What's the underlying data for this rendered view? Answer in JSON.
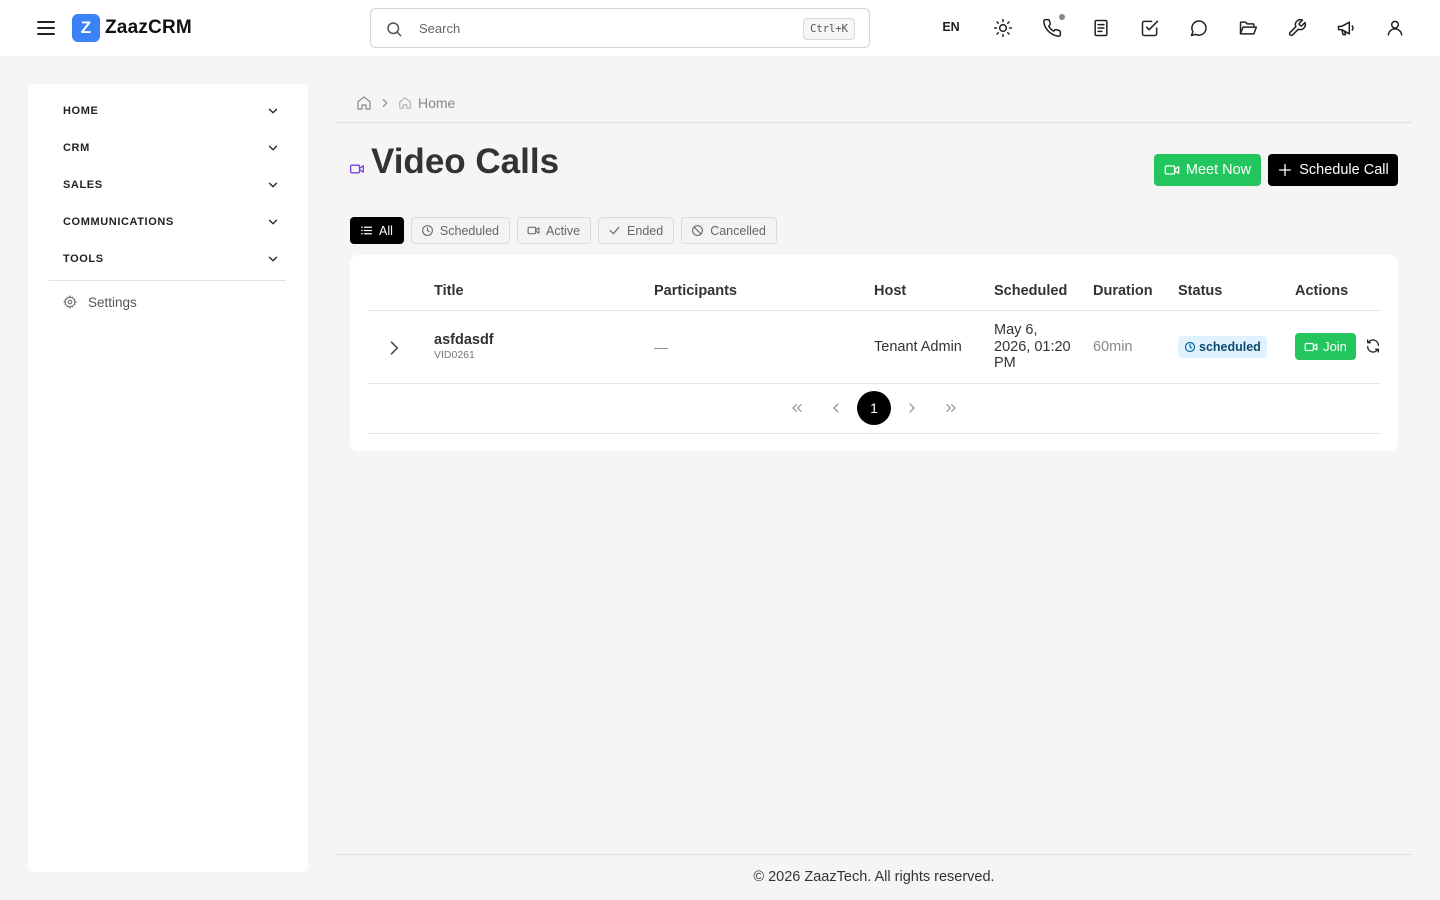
{
  "app": {
    "logo_letter": "Z",
    "name": "ZaazCRM"
  },
  "header": {
    "search_placeholder": "Search",
    "search_shortcut": "Ctrl+K",
    "language": "EN",
    "icons": [
      "sun-icon",
      "phone-icon",
      "document-icon",
      "task-check-icon",
      "chat-icon",
      "folder-open-icon",
      "wrench-icon",
      "megaphone-icon",
      "user-icon"
    ]
  },
  "sidebar": {
    "groups": [
      {
        "label": "HOME"
      },
      {
        "label": "CRM"
      },
      {
        "label": "SALES"
      },
      {
        "label": "COMMUNICATIONS"
      },
      {
        "label": "TOOLS"
      }
    ],
    "settings_label": "Settings"
  },
  "breadcrumb": {
    "current": "Home"
  },
  "page": {
    "title": "Video Calls",
    "title_icon_color": "#7c3aed",
    "meet_now_label": "Meet Now",
    "schedule_call_label": "Schedule Call"
  },
  "filters": [
    {
      "label": "All",
      "icon": "list-icon",
      "active": true
    },
    {
      "label": "Scheduled",
      "icon": "clock-icon",
      "active": false
    },
    {
      "label": "Active",
      "icon": "video-icon",
      "active": false
    },
    {
      "label": "Ended",
      "icon": "check-icon",
      "active": false
    },
    {
      "label": "Cancelled",
      "icon": "ban-icon",
      "active": false
    }
  ],
  "table": {
    "columns": [
      "Title",
      "Participants",
      "Host",
      "Scheduled",
      "Duration",
      "Status",
      "Actions"
    ],
    "rows": [
      {
        "title": "asfdasdf",
        "id": "VID0261",
        "participants": "—",
        "host": "Tenant Admin",
        "scheduled": "May 6, 2026, 01:20 PM",
        "duration": "60min",
        "status": "scheduled",
        "action_label": "Join"
      }
    ]
  },
  "pagination": {
    "current_page": "1"
  },
  "footer": {
    "text": "© 2026 ZaazTech. All rights reserved."
  },
  "colors": {
    "accent_green": "#22c55e",
    "primary_black": "#000000",
    "logo_blue": "#3b82f6",
    "status_bg": "#e0f2fe"
  }
}
